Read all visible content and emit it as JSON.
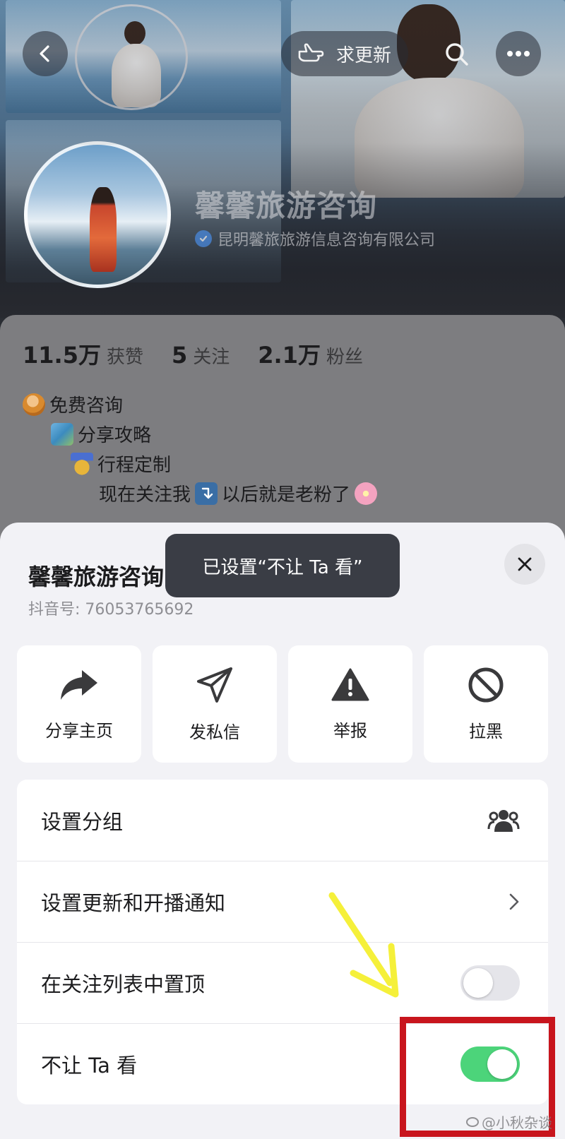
{
  "header": {
    "request_update_label": "求更新"
  },
  "profile": {
    "name": "馨馨旅游咨询",
    "verified_company": "昆明馨旅旅游信息咨询有限公司"
  },
  "stats": [
    {
      "value": "11.5万",
      "label": "获赞"
    },
    {
      "value": "5",
      "label": "关注"
    },
    {
      "value": "2.1万",
      "label": "粉丝"
    }
  ],
  "bio": {
    "line1": "免费咨询",
    "line2": "分享攻略",
    "line3": "行程定制",
    "line4a": "现在关注我",
    "line4b": "以后就是老粉了"
  },
  "sheet": {
    "title": "馨馨旅游咨询",
    "douyin_id": "抖音号: 76053765692",
    "toast": "已设置“不让 Ta 看”",
    "actions": [
      {
        "label": "分享主页",
        "icon": "share-arrow-icon"
      },
      {
        "label": "发私信",
        "icon": "paper-plane-icon"
      },
      {
        "label": "举报",
        "icon": "warning-icon"
      },
      {
        "label": "拉黑",
        "icon": "block-icon"
      }
    ],
    "rows": [
      {
        "label": "设置分组",
        "control": "group-icon"
      },
      {
        "label": "设置更新和开播通知",
        "control": "chevron-right-icon"
      },
      {
        "label": "在关注列表中置顶",
        "control": "toggle",
        "value": false
      },
      {
        "label": "不让 Ta 看",
        "control": "toggle",
        "value": true
      }
    ]
  },
  "watermark": "@小秋杂谈",
  "colors": {
    "toggle_on": "#4cd47a",
    "highlight_box": "#c8151d",
    "annotation_arrow": "#f5f03a"
  }
}
